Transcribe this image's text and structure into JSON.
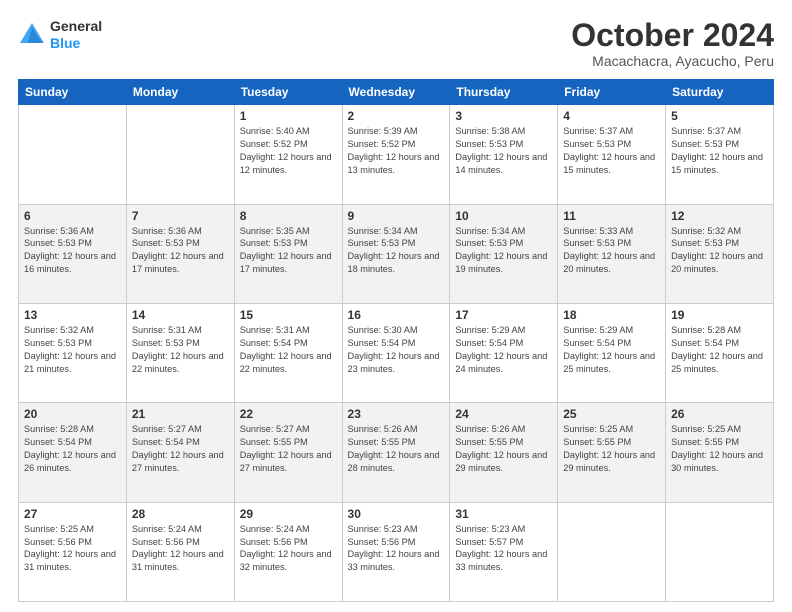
{
  "header": {
    "logo": {
      "general": "General",
      "blue": "Blue"
    },
    "title": "October 2024",
    "location": "Macachacra, Ayacucho, Peru"
  },
  "weekdays": [
    "Sunday",
    "Monday",
    "Tuesday",
    "Wednesday",
    "Thursday",
    "Friday",
    "Saturday"
  ],
  "weeks": [
    [
      {
        "day": "",
        "info": ""
      },
      {
        "day": "",
        "info": ""
      },
      {
        "day": "1",
        "info": "Sunrise: 5:40 AM\nSunset: 5:52 PM\nDaylight: 12 hours and 12 minutes."
      },
      {
        "day": "2",
        "info": "Sunrise: 5:39 AM\nSunset: 5:52 PM\nDaylight: 12 hours and 13 minutes."
      },
      {
        "day": "3",
        "info": "Sunrise: 5:38 AM\nSunset: 5:53 PM\nDaylight: 12 hours and 14 minutes."
      },
      {
        "day": "4",
        "info": "Sunrise: 5:37 AM\nSunset: 5:53 PM\nDaylight: 12 hours and 15 minutes."
      },
      {
        "day": "5",
        "info": "Sunrise: 5:37 AM\nSunset: 5:53 PM\nDaylight: 12 hours and 15 minutes."
      }
    ],
    [
      {
        "day": "6",
        "info": "Sunrise: 5:36 AM\nSunset: 5:53 PM\nDaylight: 12 hours and 16 minutes."
      },
      {
        "day": "7",
        "info": "Sunrise: 5:36 AM\nSunset: 5:53 PM\nDaylight: 12 hours and 17 minutes."
      },
      {
        "day": "8",
        "info": "Sunrise: 5:35 AM\nSunset: 5:53 PM\nDaylight: 12 hours and 17 minutes."
      },
      {
        "day": "9",
        "info": "Sunrise: 5:34 AM\nSunset: 5:53 PM\nDaylight: 12 hours and 18 minutes."
      },
      {
        "day": "10",
        "info": "Sunrise: 5:34 AM\nSunset: 5:53 PM\nDaylight: 12 hours and 19 minutes."
      },
      {
        "day": "11",
        "info": "Sunrise: 5:33 AM\nSunset: 5:53 PM\nDaylight: 12 hours and 20 minutes."
      },
      {
        "day": "12",
        "info": "Sunrise: 5:32 AM\nSunset: 5:53 PM\nDaylight: 12 hours and 20 minutes."
      }
    ],
    [
      {
        "day": "13",
        "info": "Sunrise: 5:32 AM\nSunset: 5:53 PM\nDaylight: 12 hours and 21 minutes."
      },
      {
        "day": "14",
        "info": "Sunrise: 5:31 AM\nSunset: 5:53 PM\nDaylight: 12 hours and 22 minutes."
      },
      {
        "day": "15",
        "info": "Sunrise: 5:31 AM\nSunset: 5:54 PM\nDaylight: 12 hours and 22 minutes."
      },
      {
        "day": "16",
        "info": "Sunrise: 5:30 AM\nSunset: 5:54 PM\nDaylight: 12 hours and 23 minutes."
      },
      {
        "day": "17",
        "info": "Sunrise: 5:29 AM\nSunset: 5:54 PM\nDaylight: 12 hours and 24 minutes."
      },
      {
        "day": "18",
        "info": "Sunrise: 5:29 AM\nSunset: 5:54 PM\nDaylight: 12 hours and 25 minutes."
      },
      {
        "day": "19",
        "info": "Sunrise: 5:28 AM\nSunset: 5:54 PM\nDaylight: 12 hours and 25 minutes."
      }
    ],
    [
      {
        "day": "20",
        "info": "Sunrise: 5:28 AM\nSunset: 5:54 PM\nDaylight: 12 hours and 26 minutes."
      },
      {
        "day": "21",
        "info": "Sunrise: 5:27 AM\nSunset: 5:54 PM\nDaylight: 12 hours and 27 minutes."
      },
      {
        "day": "22",
        "info": "Sunrise: 5:27 AM\nSunset: 5:55 PM\nDaylight: 12 hours and 27 minutes."
      },
      {
        "day": "23",
        "info": "Sunrise: 5:26 AM\nSunset: 5:55 PM\nDaylight: 12 hours and 28 minutes."
      },
      {
        "day": "24",
        "info": "Sunrise: 5:26 AM\nSunset: 5:55 PM\nDaylight: 12 hours and 29 minutes."
      },
      {
        "day": "25",
        "info": "Sunrise: 5:25 AM\nSunset: 5:55 PM\nDaylight: 12 hours and 29 minutes."
      },
      {
        "day": "26",
        "info": "Sunrise: 5:25 AM\nSunset: 5:55 PM\nDaylight: 12 hours and 30 minutes."
      }
    ],
    [
      {
        "day": "27",
        "info": "Sunrise: 5:25 AM\nSunset: 5:56 PM\nDaylight: 12 hours and 31 minutes."
      },
      {
        "day": "28",
        "info": "Sunrise: 5:24 AM\nSunset: 5:56 PM\nDaylight: 12 hours and 31 minutes."
      },
      {
        "day": "29",
        "info": "Sunrise: 5:24 AM\nSunset: 5:56 PM\nDaylight: 12 hours and 32 minutes."
      },
      {
        "day": "30",
        "info": "Sunrise: 5:23 AM\nSunset: 5:56 PM\nDaylight: 12 hours and 33 minutes."
      },
      {
        "day": "31",
        "info": "Sunrise: 5:23 AM\nSunset: 5:57 PM\nDaylight: 12 hours and 33 minutes."
      },
      {
        "day": "",
        "info": ""
      },
      {
        "day": "",
        "info": ""
      }
    ]
  ]
}
